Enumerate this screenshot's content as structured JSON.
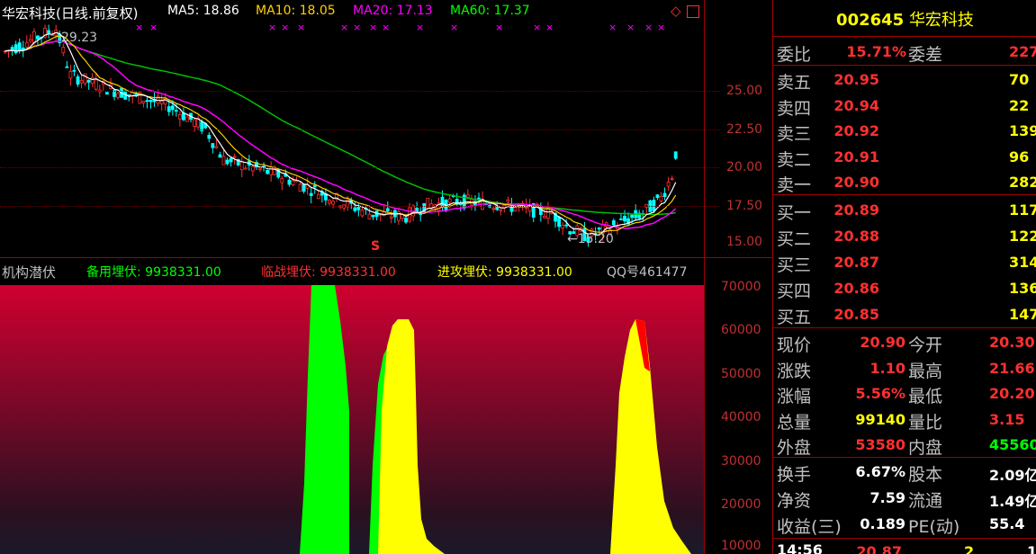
{
  "header": {
    "title": "华宏科技(日线.前复权)",
    "ma5": "MA5: 18.86",
    "ma10": "MA10: 18.05",
    "ma20": "MA20: 17.13",
    "ma60": "MA60: 17.37"
  },
  "price_axis": [
    "25.00",
    "22.50",
    "20.00",
    "17.50",
    "15.00"
  ],
  "annotations": {
    "high": "29.23",
    "low": "←15.20",
    "s_mark": "S"
  },
  "indicator": {
    "name": "机构潜伏",
    "l1": "备用埋伏: 9938331.00",
    "l2": "临战埋伏: 9938331.00",
    "l3": "进攻埋伏: 9938331.00",
    "qq": "QQ号461477"
  },
  "indicator_axis": [
    "70000",
    "60000",
    "50000",
    "40000",
    "30000",
    "20000",
    "10000"
  ],
  "colors": {
    "green": "#00ff00",
    "yellow": "#ffff00",
    "red": "#ff0000",
    "cyan": "#00ffff",
    "magenta": "#ff00ff"
  },
  "stock": {
    "code": "002645",
    "name": "华宏科技",
    "weibi_label": "委比",
    "weibi": "15.71%",
    "weicha_label": "委差",
    "weicha": "227",
    "sells": [
      {
        "label": "卖五",
        "price": "20.95",
        "vol": "70"
      },
      {
        "label": "卖四",
        "price": "20.94",
        "vol": "22"
      },
      {
        "label": "卖三",
        "price": "20.92",
        "vol": "139"
      },
      {
        "label": "卖二",
        "price": "20.91",
        "vol": "96"
      },
      {
        "label": "卖一",
        "price": "20.90",
        "vol": "282"
      }
    ],
    "buys": [
      {
        "label": "买一",
        "price": "20.89",
        "vol": "117"
      },
      {
        "label": "买二",
        "price": "20.88",
        "vol": "122"
      },
      {
        "label": "买三",
        "price": "20.87",
        "vol": "314"
      },
      {
        "label": "买四",
        "price": "20.86",
        "vol": "136"
      },
      {
        "label": "买五",
        "price": "20.85",
        "vol": "147"
      }
    ],
    "quotes": [
      {
        "l1": "现价",
        "v1": "20.90",
        "l2": "今开",
        "v2": "20.30",
        "c1": "#ff3030",
        "c2": "#ff3030"
      },
      {
        "l1": "涨跌",
        "v1": "1.10",
        "l2": "最高",
        "v2": "21.66",
        "c1": "#ff3030",
        "c2": "#ff3030"
      },
      {
        "l1": "涨幅",
        "v1": "5.56%",
        "l2": "最低",
        "v2": "20.20",
        "c1": "#ff3030",
        "c2": "#ff3030"
      },
      {
        "l1": "总量",
        "v1": "99140",
        "l2": "量比",
        "v2": "3.15",
        "c1": "#ffff00",
        "c2": "#ff3030"
      },
      {
        "l1": "外盘",
        "v1": "53580",
        "l2": "内盘",
        "v2": "45560",
        "c1": "#ff3030",
        "c2": "#00ff00"
      }
    ],
    "fundamentals": [
      {
        "l1": "换手",
        "v1": "6.67%",
        "l2": "股本",
        "v2": "2.09亿"
      },
      {
        "l1": "净资",
        "v1": "7.59",
        "l2": "流通",
        "v2": "1.49亿"
      },
      {
        "l1": "收益(三)",
        "v1": "0.189",
        "l2": "PE(动)",
        "v2": "55.4"
      }
    ],
    "tick": {
      "time": "14:56",
      "price": "20.87",
      "vol": "2",
      "extra": "1"
    }
  }
}
